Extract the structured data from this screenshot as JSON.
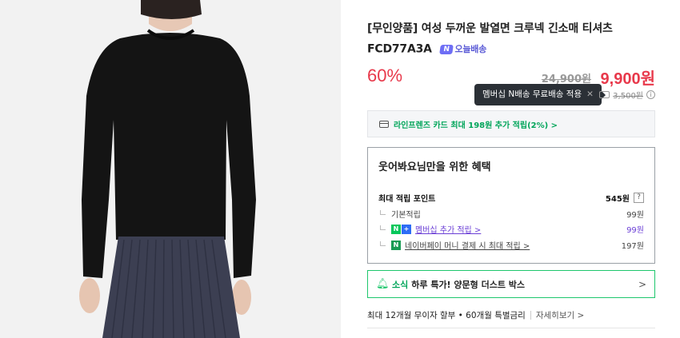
{
  "product": {
    "title": "[무인양품] 여성 두꺼운 발열면 크루넥 긴소매 티셔츠 FCD77A3A",
    "today_delivery": "오늘배송",
    "today_delivery_icon": "N"
  },
  "price": {
    "discount": "60%",
    "original": "24,900원",
    "sale": "9,900원"
  },
  "shipping": {
    "tooltip": "멤버십 N배송 무료배송 적용",
    "tooltip_close": "✕",
    "fee": "3,500원",
    "info_icon": "i"
  },
  "card_promo": {
    "text": "라인프렌즈 카드 최대 198원 추가 적립(2%) >"
  },
  "benefits": {
    "title": "웃어봐요님만을 위한 혜택",
    "max_points_label": "최대 적립 포인트",
    "max_points_value": "545원",
    "help_icon": "?",
    "rows": [
      {
        "label": "기본적립",
        "value": "99원"
      },
      {
        "label": "멤버십 추가 적립 >",
        "value": "99원",
        "tag1": "N",
        "tag2": "+"
      },
      {
        "label": "네이버페이 머니 결제 시 최대 적립 >",
        "value": "197원",
        "tag1": "N"
      }
    ]
  },
  "news": {
    "label": "소식",
    "text": "하루 특가! 양문형 더스트 박스",
    "chevron": ">"
  },
  "installment": {
    "text": "최대 12개월 무이자 할부 • 60개월 특별금리",
    "more": "자세히보기 >"
  },
  "colors": {
    "accent_red": "#e8394b",
    "naver_green": "#03c75a",
    "membership_purple": "#6b3fd6"
  }
}
